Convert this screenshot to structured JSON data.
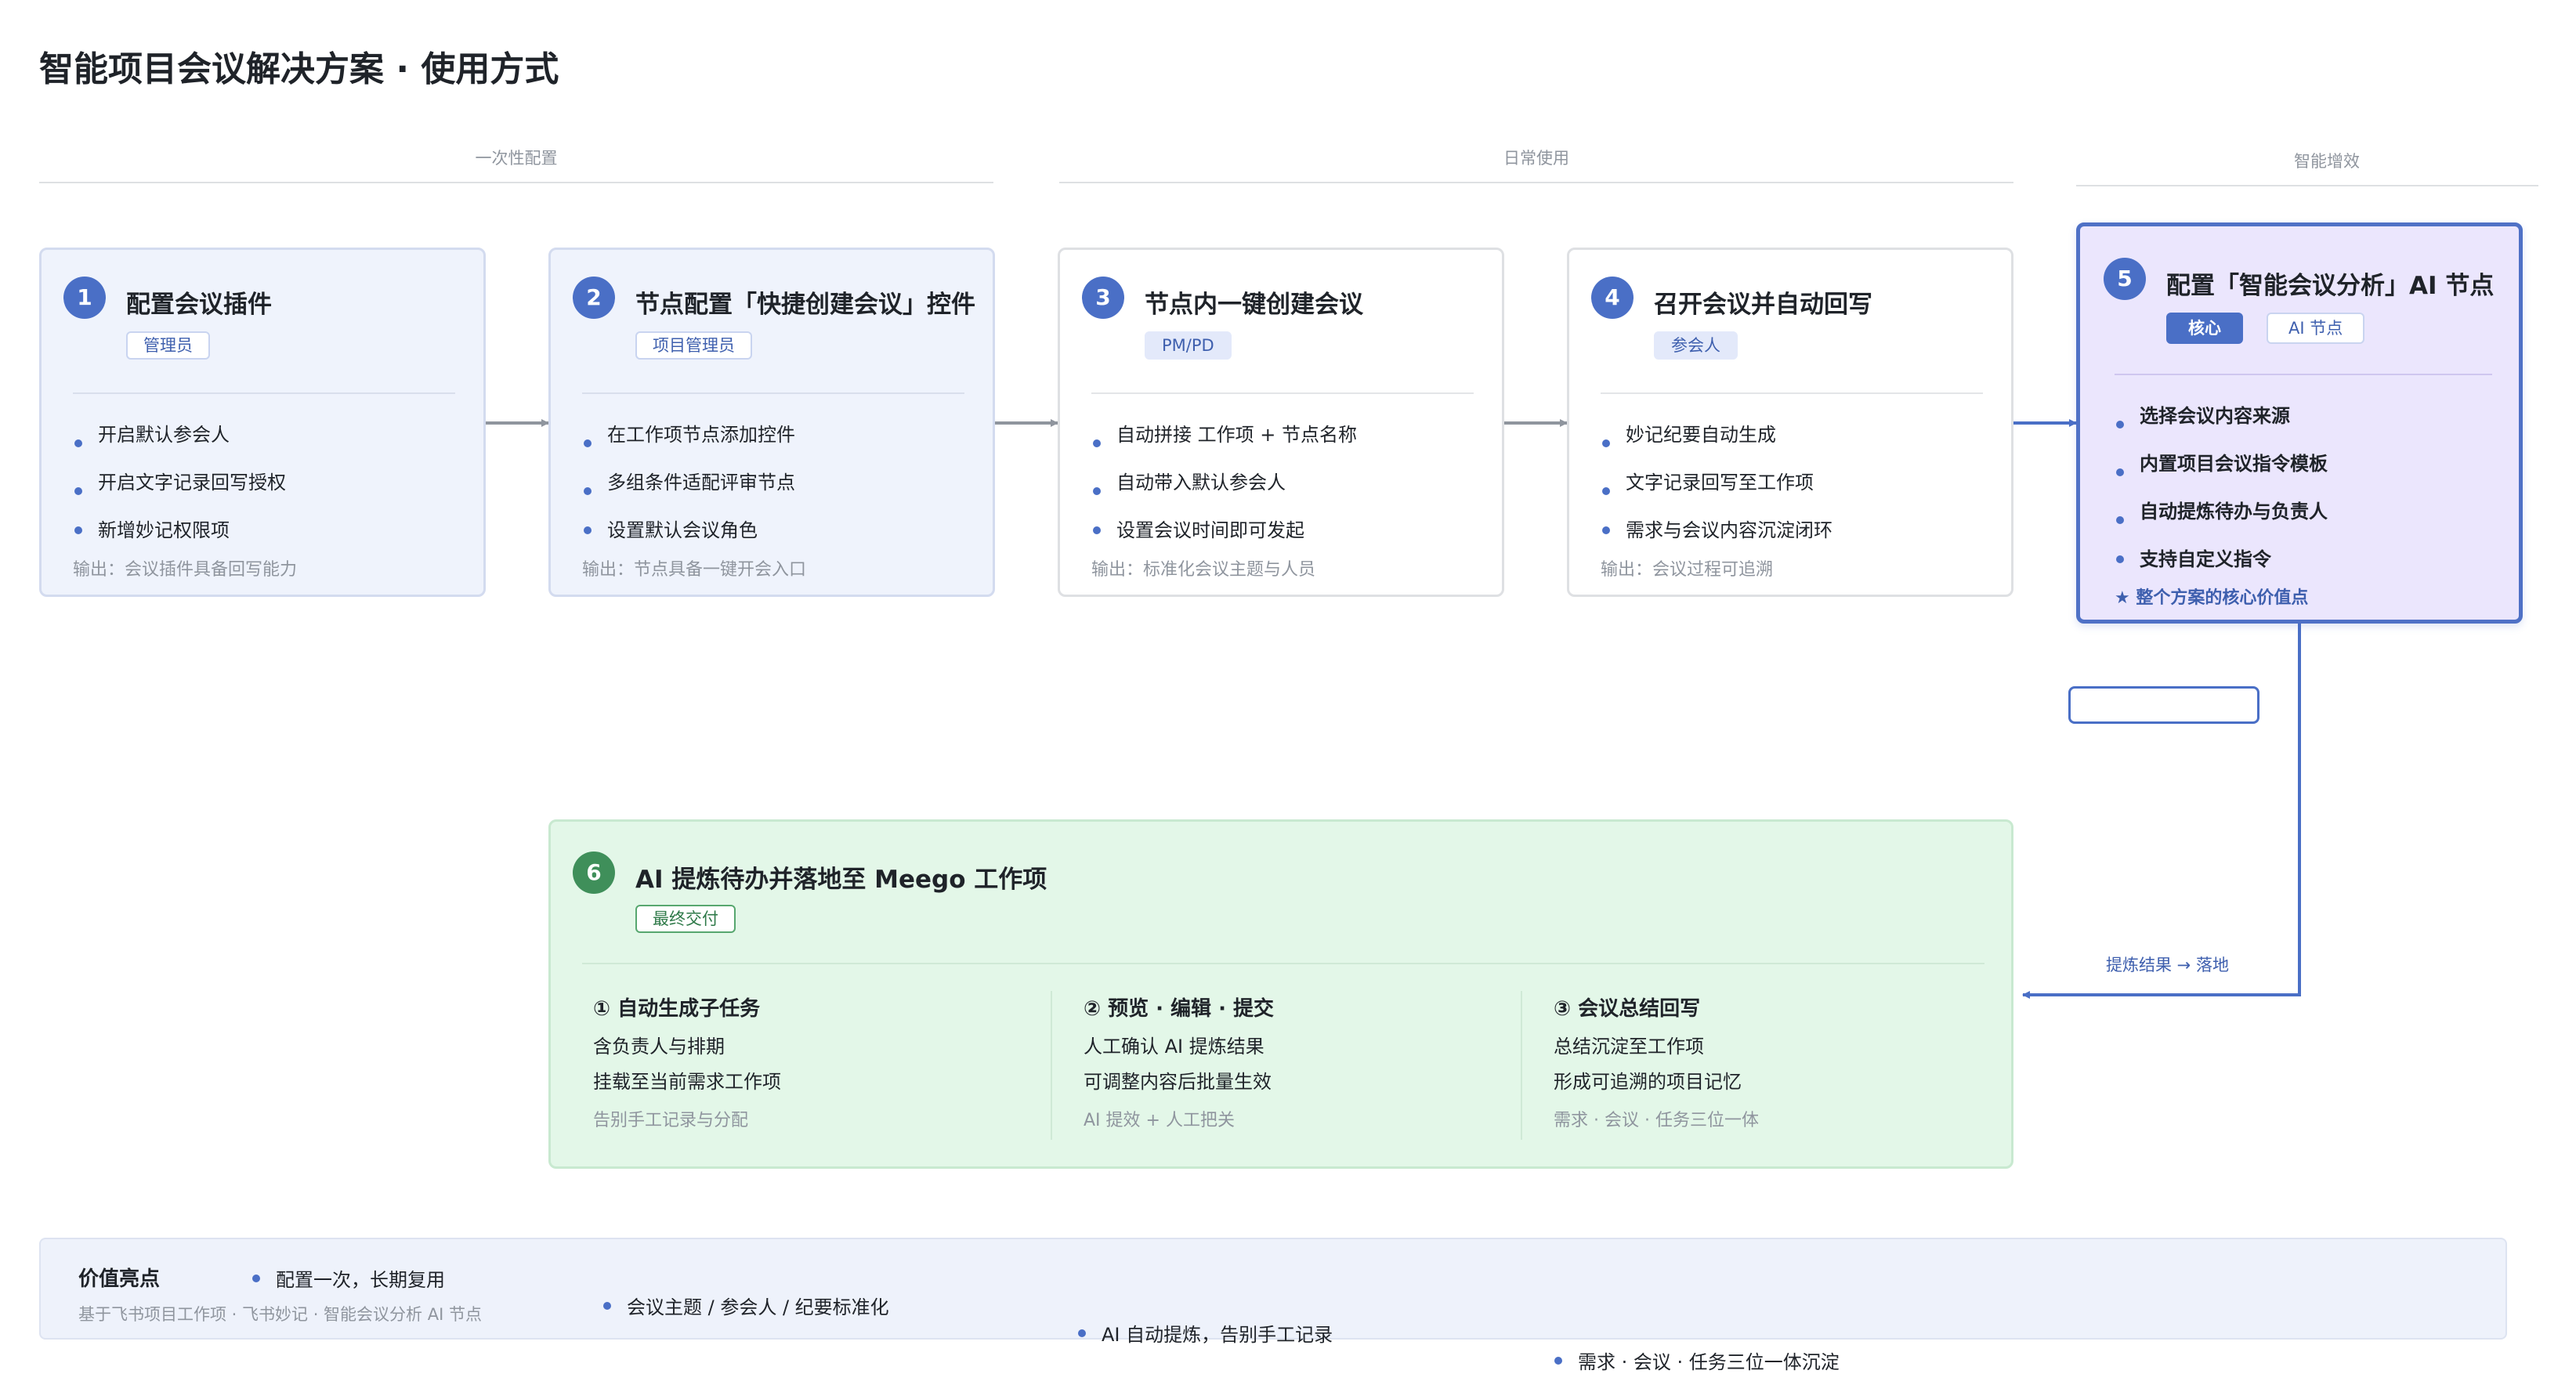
{
  "title": "智能项目会议解决方案 · 使用方式",
  "phases": [
    "一次性配置",
    "日常使用",
    "智能增效"
  ],
  "steps": [
    {
      "num": "1",
      "title": "配置会议插件",
      "tag": "管理员",
      "bullets": [
        "开启默认参会人",
        "开启文字记录回写授权",
        "新增妙记权限项"
      ],
      "output": "输出：会议插件具备回写能力"
    },
    {
      "num": "2",
      "title": "节点配置「快捷创建会议」控件",
      "tag": "项目管理员",
      "bullets": [
        "在工作项节点添加控件",
        "多组条件适配评审节点",
        "设置默认会议角色"
      ],
      "output": "输出：节点具备一键开会入口"
    },
    {
      "num": "3",
      "title": "节点内一键创建会议",
      "tag": "PM/PD",
      "bullets": [
        "自动拼接 工作项 + 节点名称",
        "自动带入默认参会人",
        "设置会议时间即可发起"
      ],
      "output": "输出：标准化会议主题与人员"
    },
    {
      "num": "4",
      "title": "召开会议并自动回写",
      "tag": "参会人",
      "bullets": [
        "妙记纪要自动生成",
        "文字记录回写至工作项",
        "需求与会议内容沉淀闭环"
      ],
      "output": "输出：会议过程可追溯"
    },
    {
      "num": "5",
      "title": "配置「智能会议分析」AI 节点",
      "tags": [
        "核心",
        "AI 节点"
      ],
      "bullets": [
        "选择会议内容来源",
        "内置项目会议指令模板",
        "自动提炼待办与负责人",
        "支持自定义指令"
      ],
      "note": "★ 整个方案的核心价值点"
    }
  ],
  "final": {
    "num": "6",
    "title": "AI 提炼待办并落地至 Meego 工作项",
    "tag": "最终交付",
    "columns": [
      {
        "title": "① 自动生成子任务",
        "lines": [
          "含负责人与排期",
          "挂载至当前需求工作项"
        ],
        "foot": "告别手工记录与分配"
      },
      {
        "title": "② 预览 · 编辑 · 提交",
        "lines": [
          "人工确认 AI 提炼结果",
          "可调整内容后批量生效"
        ],
        "foot": "AI 提效 + 人工把关"
      },
      {
        "title": "③ 会议总结回写",
        "lines": [
          "总结沉淀至工作项",
          "形成可追溯的项目记忆"
        ],
        "foot": "需求 · 会议 · 任务三位一体"
      }
    ]
  },
  "connector_label": "提炼结果 → 落地",
  "value_bar": {
    "title": "价值亮点",
    "items": [
      "配置一次，长期复用",
      "会议主题 / 参会人 / 纪要标准化",
      "AI 自动提炼，告别手工记录",
      "需求 · 会议 · 任务三位一体沉淀"
    ],
    "footer": "基于飞书项目工作项 · 飞书妙记 · 智能会议分析 AI 节点"
  },
  "colors": {
    "accent": "#4a6fc6",
    "config_card_bg": "#eff3fc",
    "ai_card_bg": "#ebe6fd",
    "final_card_bg": "#e3f7e8",
    "final_accent": "#3f8f5a",
    "arrow": "#8f959e"
  }
}
